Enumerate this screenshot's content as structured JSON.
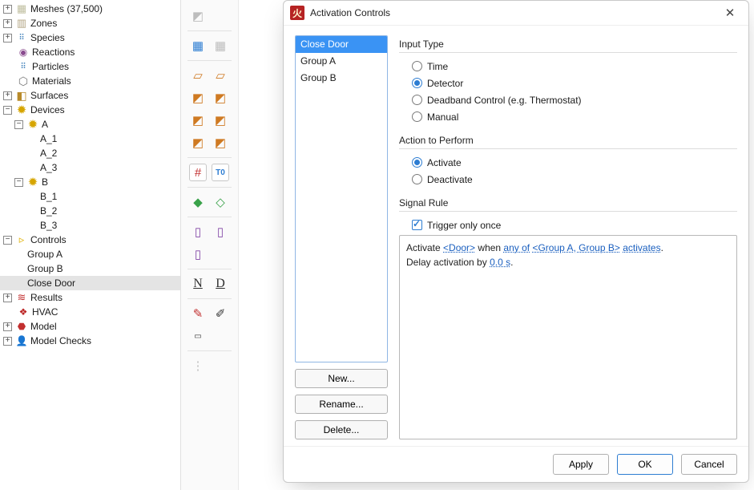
{
  "tree": {
    "meshes": "Meshes (37,500)",
    "zones": "Zones",
    "species": "Species",
    "reactions": "Reactions",
    "particles": "Particles",
    "materials": "Materials",
    "surfaces": "Surfaces",
    "devices": "Devices",
    "dev_A": "A",
    "dev_A1": "A_1",
    "dev_A2": "A_2",
    "dev_A3": "A_3",
    "dev_B": "B",
    "dev_B1": "B_1",
    "dev_B2": "B_2",
    "dev_B3": "B_3",
    "controls": "Controls",
    "ctrl_groupA": "Group A",
    "ctrl_groupB": "Group B",
    "ctrl_closeDoor": "Close Door",
    "results": "Results",
    "hvac": "HVAC",
    "model": "Model",
    "model_checks": "Model Checks"
  },
  "dialog": {
    "title": "Activation Controls",
    "list": {
      "i0": "Close Door",
      "i1": "Group A",
      "i2": "Group B"
    },
    "buttons": {
      "new": "New...",
      "rename": "Rename...",
      "delete": "Delete..."
    },
    "groups": {
      "input_type": "Input Type",
      "action": "Action to Perform",
      "signal": "Signal Rule"
    },
    "input_type": {
      "time": "Time",
      "detector": "Detector",
      "deadband": "Deadband Control (e.g. Thermostat)",
      "manual": "Manual"
    },
    "action": {
      "activate": "Activate",
      "deactivate": "Deactivate"
    },
    "signal": {
      "trigger_once": "Trigger only once"
    },
    "rule": {
      "prefix": "Activate ",
      "door_link": "<Door>",
      "mid1": " when ",
      "any_link": "any of",
      "mid2": " ",
      "group_link": "<Group A, Group B>",
      "mid3": " ",
      "activates_link": "activates",
      "suffix": ".",
      "line2a": "Delay activation by ",
      "delay_link": "0.0 s",
      "line2b": "."
    },
    "footer": {
      "apply": "Apply",
      "ok": "OK",
      "cancel": "Cancel"
    }
  },
  "glyphs": {
    "plus": "+",
    "minus": "−",
    "close": "✕",
    "mesh": "▦",
    "zone": "▥",
    "gear": "✹",
    "react": "◉",
    "dots": "⠿",
    "cyl": "⬡",
    "surf": "◧",
    "ctrl": "▹",
    "res": "≋",
    "hvac": "❖",
    "model": "⬣",
    "check": "👤",
    "cube": "◩",
    "slab": "▱",
    "hash": "#",
    "tile": "▦",
    "t0": "T0",
    "greendot": "◆",
    "greenc": "◇",
    "book": "▯",
    "N": "N",
    "D": "D",
    "hammer": "✎",
    "dropper": "✐",
    "ruler": "▭",
    "bullets": "⋮"
  }
}
